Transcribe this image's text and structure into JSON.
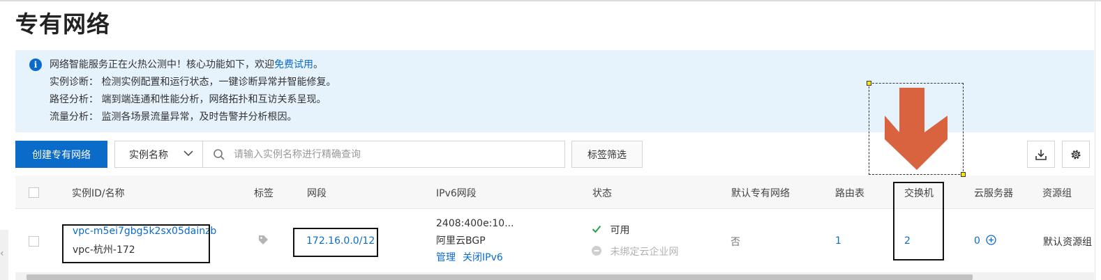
{
  "page": {
    "title": "专有网络"
  },
  "notice": {
    "intro_prefix": "网络智能服务正在火热公测中！核心功能如下，欢迎",
    "intro_link": "免费试用",
    "intro_suffix": "。",
    "lines": [
      "实例诊断：  检测实例配置和运行状态，一键诊断异常并智能修复。",
      "路径分析：  端到端连通和性能分析，网络拓扑和互访关系呈现。",
      "流量分析：  监测各场景流量异常，及时告警并分析根因。"
    ],
    "icon": "info-icon",
    "colors": {
      "background": "#e6f3fd",
      "icon": "#0b6bc9"
    }
  },
  "toolbar": {
    "create_label": "创建专有网络",
    "filter_select_value": "实例名称",
    "search_placeholder": "请输入实例名称进行精确查询",
    "tag_filter_label": "标签筛选",
    "download_icon": "download-icon",
    "settings_icon": "gear-icon"
  },
  "table": {
    "headers": [
      "实例ID/名称",
      "标签",
      "网段",
      "IPv6网段",
      "状态",
      "默认专有网络",
      "路由表",
      "交换机",
      "云服务器",
      "资源组"
    ],
    "rows": [
      {
        "id": "vpc-m5ei7gbg5k2sx05dainzb",
        "name": "vpc-杭州-172",
        "tag_icon": "tag-icon",
        "cidr": "172.16.0.0/12",
        "ipv6_cidr": "2408:400e:10...",
        "ipv6_isp": "阿里云BGP",
        "ipv6_manage": "管理",
        "ipv6_disable": "关闭IPv6",
        "status": "可用",
        "cen_status": "未绑定云企业网",
        "is_default": "否",
        "route_tables": "1",
        "vswitches": "2",
        "ecs": "0",
        "resource_group": "默认资源组"
      }
    ]
  },
  "colors": {
    "primary": "#0b6bc9",
    "success": "#2ba245",
    "annotation_arrow": "#d9623f",
    "annotation_handle": "#ffe600"
  }
}
